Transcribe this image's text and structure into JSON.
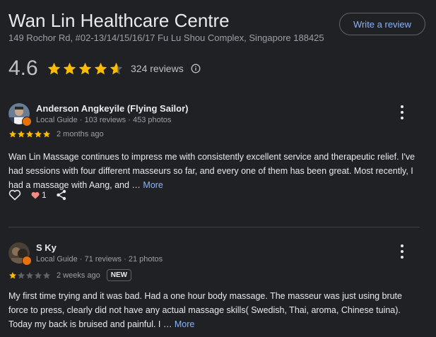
{
  "business": {
    "name": "Wan Lin Healthcare Centre",
    "address": "149 Rochor Rd, #02-13/14/15/16/17 Fu Lu Shou Complex, Singapore 188425",
    "write_review_label": "Write a review",
    "rating": "4.6",
    "rating_value": 4.6,
    "reviews_count_label": "324 reviews"
  },
  "colors": {
    "background": "#202124",
    "star": "#fbbc04",
    "star_empty": "#5f6368",
    "link": "#8ab4f8",
    "heart": "#f28b82",
    "guide_badge": "#e8710a"
  },
  "reviews": [
    {
      "name": "Anderson Angkeyile (Flying Sailor)",
      "meta": "Local Guide · 103 reviews · 453 photos",
      "stars": 5,
      "date": "2 months ago",
      "badge": "",
      "text": "Wan Lin Massage continues to impress me with consistently excellent service and therapeutic relief. I've had sessions with four different masseurs so far, and every one of them has been great. Most recently, I had a massage with Aang, and … ",
      "more_label": "More",
      "likes": "1"
    },
    {
      "name": "S Ky",
      "meta": "Local Guide · 71 reviews · 21 photos",
      "stars": 1,
      "date": "2 weeks ago",
      "badge": "NEW",
      "text": "My first time trying and it was bad. Had a one hour body massage. The masseur was just using brute force to press, clearly did not have any actual massage skills( Swedish, Thai, aroma, Chinese tuina). Today my back is bruised and painful. I … ",
      "more_label": "More"
    }
  ]
}
